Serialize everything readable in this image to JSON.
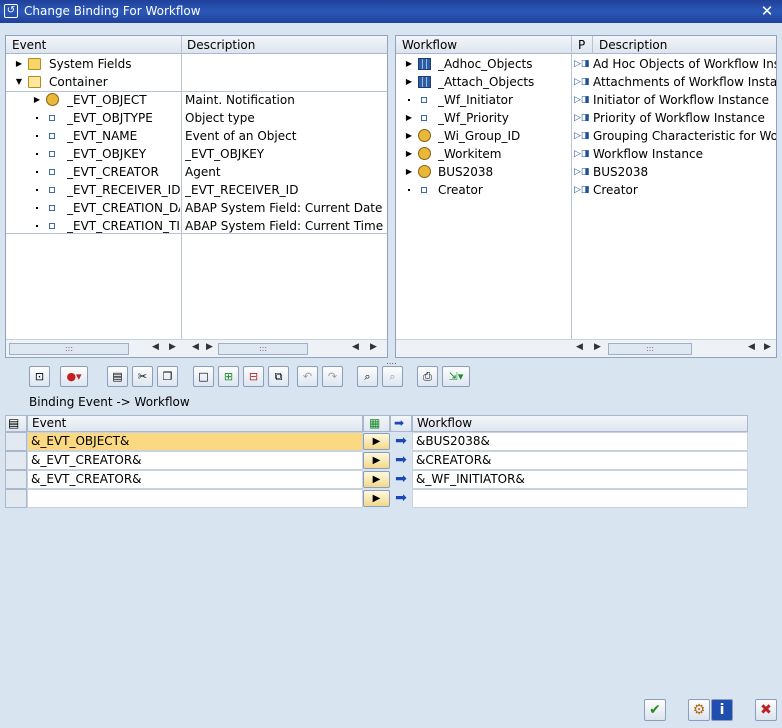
{
  "window": {
    "title": "Change Binding For Workflow",
    "close_icon": "close-icon"
  },
  "left_tree": {
    "headers": [
      "Event",
      "Description"
    ],
    "rows": [
      {
        "name": "System Fields",
        "desc": "",
        "icon": "folder-icon",
        "level": 0,
        "expand": "collapsed"
      },
      {
        "name": "Container",
        "desc": "",
        "icon": "folder-open-icon",
        "level": 0,
        "expand": "expanded"
      },
      {
        "name": "_EVT_OBJECT",
        "desc": "Maint. Notification",
        "icon": "object-icon",
        "level": 1,
        "expand": "collapsed"
      },
      {
        "name": "_EVT_OBJTYPE",
        "desc": "Object type",
        "icon": "element-icon",
        "level": 1,
        "expand": "leaf"
      },
      {
        "name": "_EVT_NAME",
        "desc": "Event of an Object",
        "icon": "element-icon",
        "level": 1,
        "expand": "leaf"
      },
      {
        "name": "_EVT_OBJKEY",
        "desc": "_EVT_OBJKEY",
        "icon": "element-icon",
        "level": 1,
        "expand": "leaf"
      },
      {
        "name": "_EVT_CREATOR",
        "desc": "Agent",
        "icon": "element-icon",
        "level": 1,
        "expand": "leaf"
      },
      {
        "name": "_EVT_RECEIVER_ID",
        "desc": "_EVT_RECEIVER_ID",
        "icon": "element-icon",
        "level": 1,
        "expand": "leaf"
      },
      {
        "name": "_EVT_CREATION_DA",
        "desc": "ABAP System Field: Current Date of A",
        "icon": "element-icon",
        "level": 1,
        "expand": "leaf"
      },
      {
        "name": "_EVT_CREATION_TI",
        "desc": "ABAP System Field: Current Time of A",
        "icon": "element-icon",
        "level": 1,
        "expand": "leaf"
      }
    ]
  },
  "right_tree": {
    "headers": [
      "Workflow",
      "P",
      "Description"
    ],
    "rows": [
      {
        "name": "_Adhoc_Objects",
        "desc": "Ad Hoc Objects of Workflow Inst",
        "icon": "table-icon",
        "expand": "collapsed"
      },
      {
        "name": "_Attach_Objects",
        "desc": "Attachments of Workflow Instanc",
        "icon": "table-icon",
        "expand": "collapsed"
      },
      {
        "name": "_Wf_Initiator",
        "desc": "Initiator of Workflow Instance",
        "icon": "element-icon",
        "expand": "leaf"
      },
      {
        "name": "_Wf_Priority",
        "desc": "Priority of Workflow Instance",
        "icon": "element-icon",
        "expand": "collapsed"
      },
      {
        "name": "_Wi_Group_ID",
        "desc": "Grouping Characteristic for Workfl",
        "icon": "object-icon",
        "expand": "collapsed"
      },
      {
        "name": "_Workitem",
        "desc": "Workflow Instance",
        "icon": "object-icon",
        "expand": "collapsed"
      },
      {
        "name": "BUS2038",
        "desc": "BUS2038",
        "icon": "object-icon",
        "expand": "collapsed"
      },
      {
        "name": "Creator",
        "desc": "Creator",
        "icon": "element-icon",
        "expand": "leaf"
      }
    ]
  },
  "toolbar": {
    "buttons": [
      "lock-icon",
      "delete-icon",
      "paste-icon",
      "cut-icon",
      "copy-icon",
      "new-icon",
      "insert-icon",
      "remove-icon",
      "duplicate-icon",
      "undo-icon",
      "redo-icon",
      "find-icon",
      "find-next-icon",
      "print-icon",
      "export-icon"
    ]
  },
  "binding": {
    "caption": "Binding Event  -> Workflow",
    "headers": {
      "event": "Event",
      "workflow": "Workflow"
    },
    "rows": [
      {
        "event": "&_EVT_OBJECT&",
        "workflow": "&BUS2038&",
        "selected": true
      },
      {
        "event": "&_EVT_CREATOR&",
        "workflow": "&CREATOR&",
        "selected": false
      },
      {
        "event": "&_EVT_CREATOR&",
        "workflow": "&_WF_INITIATOR&",
        "selected": false
      },
      {
        "event": "",
        "workflow": "",
        "selected": false
      }
    ]
  },
  "footer": {
    "buttons": [
      "confirm-icon",
      "binding-check-icon",
      "info-icon",
      "cancel-icon"
    ]
  },
  "colors": {
    "accent": "#20409a",
    "highlight_row": "#fbd982",
    "background": "#d9e4f1"
  }
}
